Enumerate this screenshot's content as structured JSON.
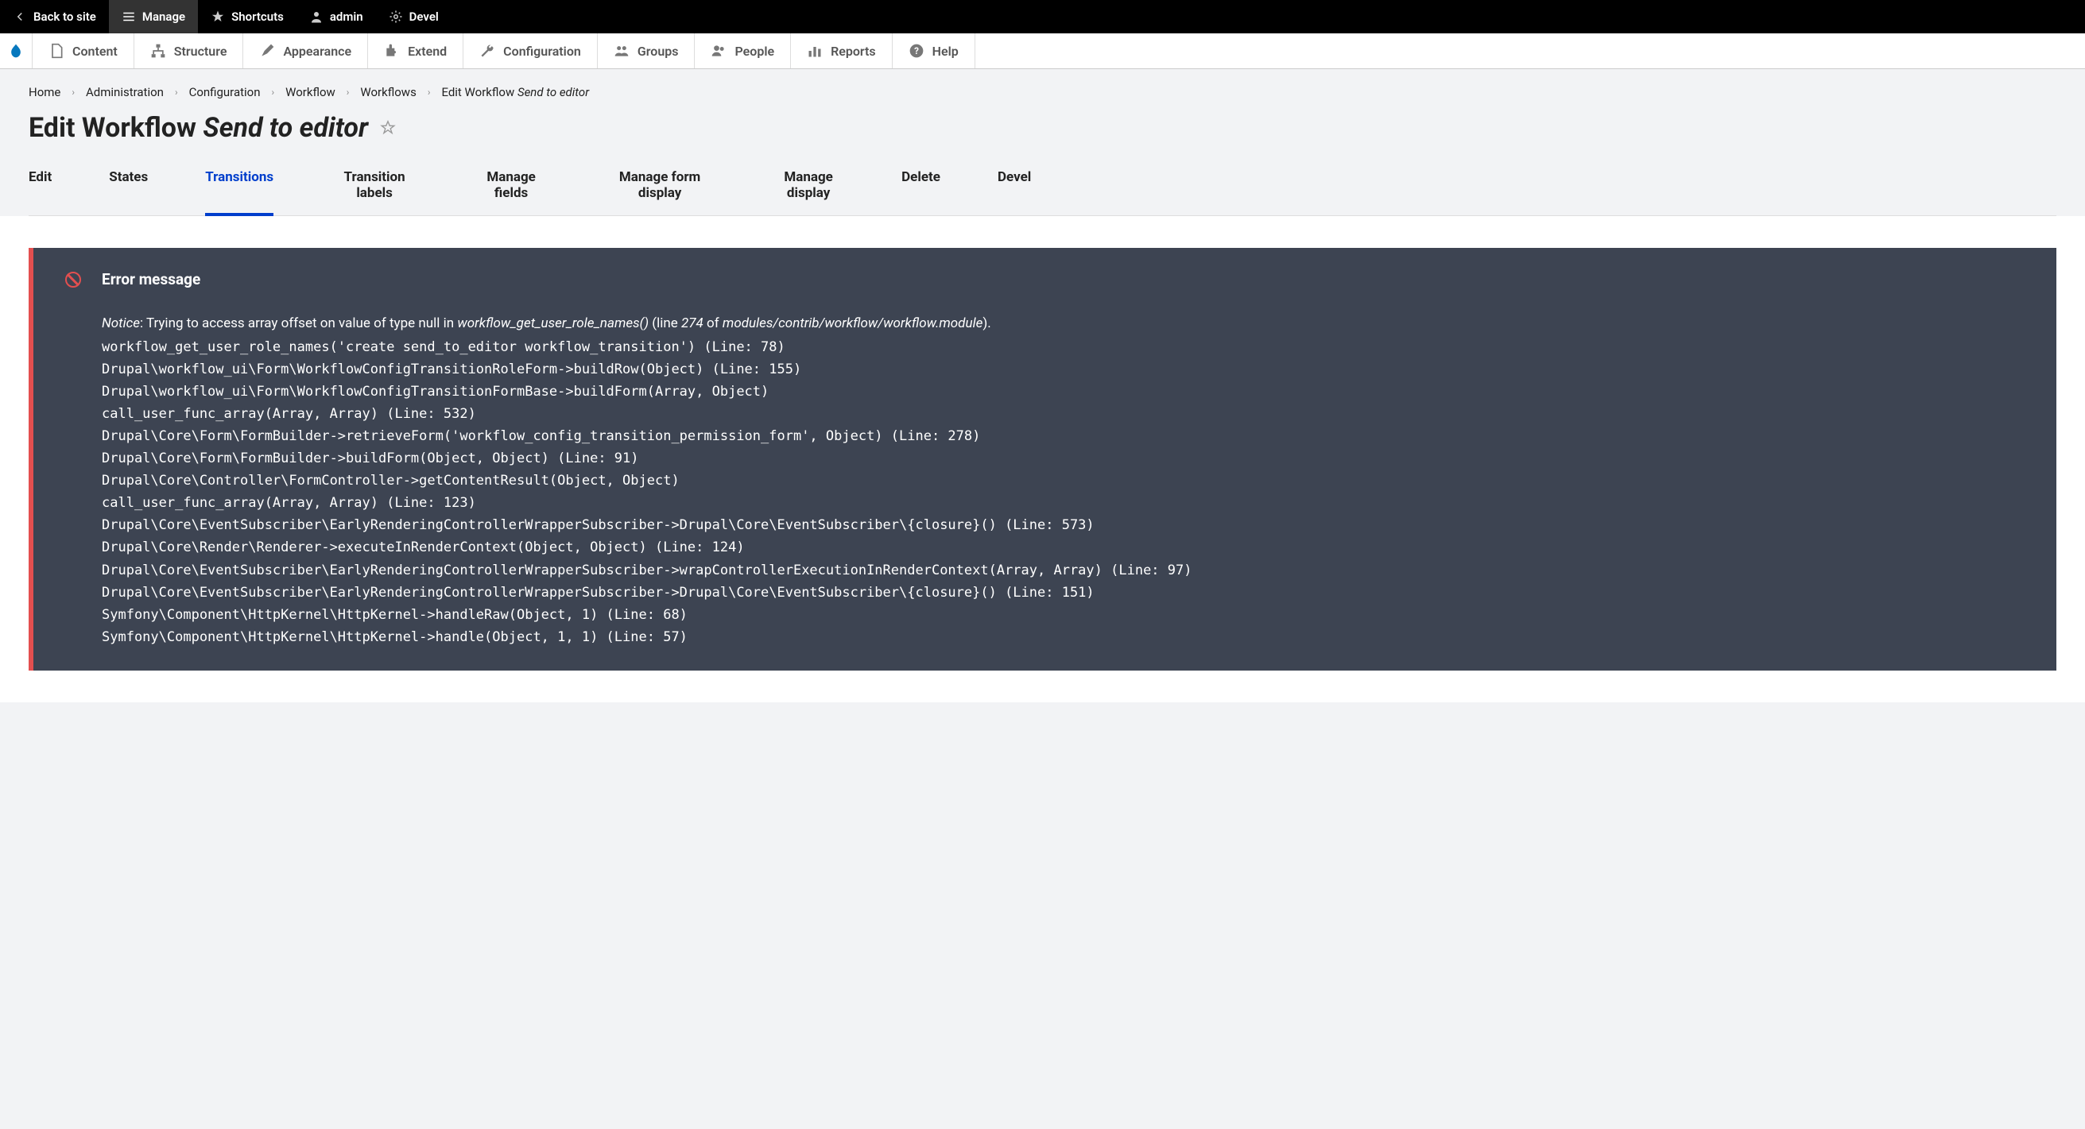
{
  "toolbar_top": {
    "back": "Back to site",
    "manage": "Manage",
    "shortcuts": "Shortcuts",
    "admin": "admin",
    "devel": "Devel"
  },
  "toolbar_admin": {
    "content": "Content",
    "structure": "Structure",
    "appearance": "Appearance",
    "extend": "Extend",
    "configuration": "Configuration",
    "groups": "Groups",
    "people": "People",
    "reports": "Reports",
    "help": "Help"
  },
  "breadcrumb": {
    "items": [
      "Home",
      "Administration",
      "Configuration",
      "Workflow",
      "Workflows"
    ],
    "current_prefix": "Edit Workflow ",
    "current_em": "Send to editor"
  },
  "page_title": {
    "prefix": "Edit Workflow ",
    "em": "Send to editor"
  },
  "tabs": [
    {
      "label": "Edit",
      "active": false
    },
    {
      "label": "States",
      "active": false
    },
    {
      "label": "Transitions",
      "active": true
    },
    {
      "label": "Transition labels",
      "active": false
    },
    {
      "label": "Manage fields",
      "active": false
    },
    {
      "label": "Manage form display",
      "active": false
    },
    {
      "label": "Manage display",
      "active": false
    },
    {
      "label": "Delete",
      "active": false
    },
    {
      "label": "Devel",
      "active": false
    }
  ],
  "error": {
    "heading": "Error message",
    "notice_prefix": "Notice",
    "notice_body1": ": Trying to access array offset on value of type null in ",
    "notice_func": "workflow_get_user_role_names()",
    "notice_body2": " (line ",
    "notice_line": "274",
    "notice_body3": " of ",
    "notice_file": "modules/contrib/workflow/workflow.module",
    "notice_body4": ").",
    "trace": "workflow_get_user_role_names('create send_to_editor workflow_transition') (Line: 78)\nDrupal\\workflow_ui\\Form\\WorkflowConfigTransitionRoleForm->buildRow(Object) (Line: 155)\nDrupal\\workflow_ui\\Form\\WorkflowConfigTransitionFormBase->buildForm(Array, Object)\ncall_user_func_array(Array, Array) (Line: 532)\nDrupal\\Core\\Form\\FormBuilder->retrieveForm('workflow_config_transition_permission_form', Object) (Line: 278)\nDrupal\\Core\\Form\\FormBuilder->buildForm(Object, Object) (Line: 91)\nDrupal\\Core\\Controller\\FormController->getContentResult(Object, Object)\ncall_user_func_array(Array, Array) (Line: 123)\nDrupal\\Core\\EventSubscriber\\EarlyRenderingControllerWrapperSubscriber->Drupal\\Core\\EventSubscriber\\{closure}() (Line: 573)\nDrupal\\Core\\Render\\Renderer->executeInRenderContext(Object, Object) (Line: 124)\nDrupal\\Core\\EventSubscriber\\EarlyRenderingControllerWrapperSubscriber->wrapControllerExecutionInRenderContext(Array, Array) (Line: 97)\nDrupal\\Core\\EventSubscriber\\EarlyRenderingControllerWrapperSubscriber->Drupal\\Core\\EventSubscriber\\{closure}() (Line: 151)\nSymfony\\Component\\HttpKernel\\HttpKernel->handleRaw(Object, 1) (Line: 68)\nSymfony\\Component\\HttpKernel\\HttpKernel->handle(Object, 1, 1) (Line: 57)"
  }
}
